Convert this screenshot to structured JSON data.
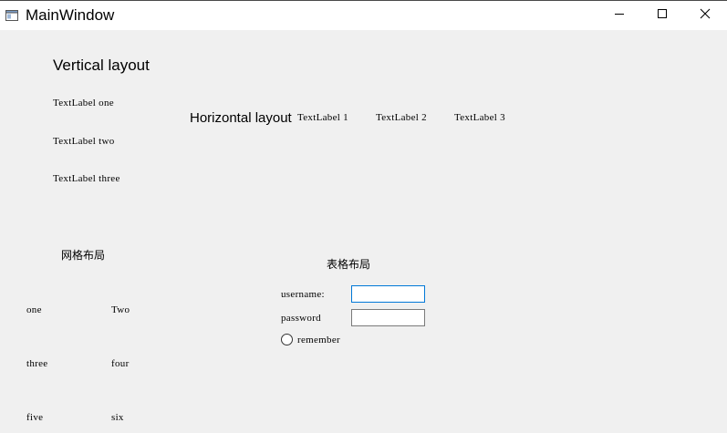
{
  "window": {
    "title": "MainWindow"
  },
  "vertical_layout": {
    "title": "Vertical layout",
    "labels": [
      "TextLabel one",
      "TextLabel two",
      "TextLabel three"
    ]
  },
  "horizontal_layout": {
    "title": "Horizontal layout",
    "labels": [
      "TextLabel 1",
      "TextLabel 2",
      "TextLabel 3"
    ]
  },
  "grid_layout": {
    "title": "网格布局",
    "cells": [
      "one",
      "Two",
      "three",
      "four",
      "five",
      "six"
    ]
  },
  "form_layout": {
    "title": "表格布局",
    "username_label": "username:",
    "username_value": "",
    "password_label": "password",
    "password_value": "",
    "remember_label": "remember",
    "remember_checked": false
  },
  "colors": {
    "window_bg": "#f0f0f0",
    "titlebar_bg": "#ffffff",
    "focus_border": "#0078d7"
  },
  "icons": {
    "app": "window-app-icon",
    "minimize": "minimize-icon",
    "maximize": "maximize-icon",
    "close": "close-icon"
  }
}
